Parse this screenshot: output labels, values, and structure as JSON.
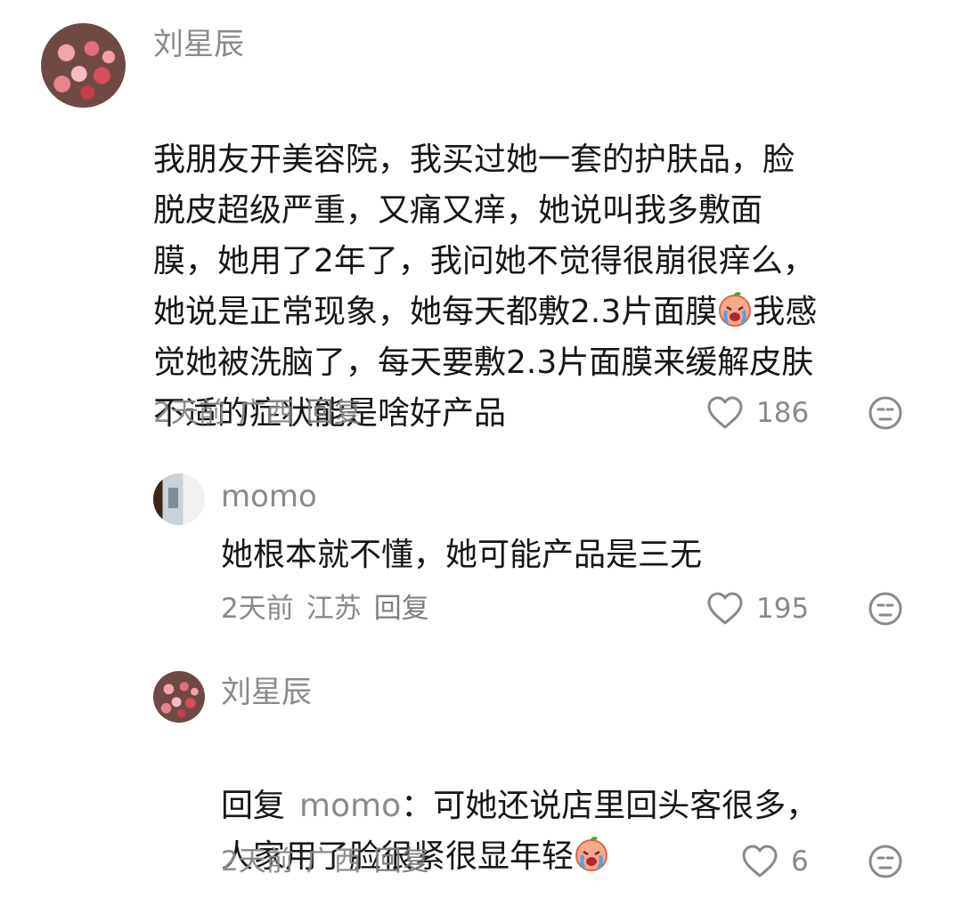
{
  "comments": [
    {
      "username": "刘星辰",
      "text": "我朋友开美容院，我买过她一套的护肤品，脸\n脱皮超级严重，又痛又痒，她说叫我多敷面\n膜，她用了2年了，我问她不觉得很崩很痒么，\n她说是正常现象，她每天都敷2.3片面膜",
      "text_after_emoji": "我感\n觉她被洗脑了，每天要敷2.3片面膜来缓解皮肤\n不适的症状能是啥好产品",
      "time": "2天前",
      "location": "广西",
      "reply_label": "回复",
      "likes": "186"
    },
    {
      "username": "momo",
      "text": "她根本就不懂，她可能产品是三无",
      "time": "2天前",
      "location": "江苏",
      "reply_label": "回复",
      "likes": "195"
    },
    {
      "username": "刘星辰",
      "reply_prefix": "回复",
      "reply_to": "momo",
      "reply_colon": "：",
      "text": "可她还说店里回头客很多，",
      "text_line2": "人家用了脸很紧很显年轻",
      "time": "2天前",
      "location": "广西",
      "reply_label": "回复",
      "likes": "6"
    }
  ],
  "icons": {
    "like": "heart-outline-icon",
    "dislike": "unamused-face-icon",
    "emoji": "crying-face-emoji"
  },
  "colors": {
    "text": "#161616",
    "secondary": "#8a8a8a"
  }
}
